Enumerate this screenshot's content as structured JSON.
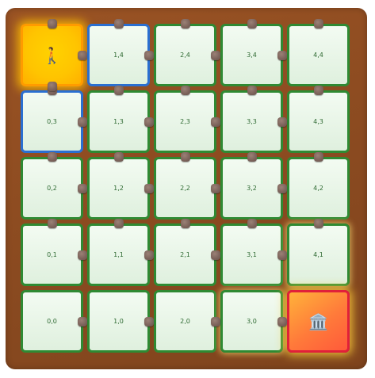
{
  "grid": {
    "rows": [
      [
        {
          "label": "",
          "icon": "🚶",
          "icon_name": "walking-person-icon",
          "state": "current"
        },
        {
          "label": "1,4",
          "state": "visited"
        },
        {
          "label": "2,4",
          "state": "normal"
        },
        {
          "label": "3,4",
          "state": "normal"
        },
        {
          "label": "4,4",
          "state": "normal"
        }
      ],
      [
        {
          "label": "0,3",
          "state": "visited"
        },
        {
          "label": "1,3",
          "state": "normal"
        },
        {
          "label": "2,3",
          "state": "normal"
        },
        {
          "label": "3,3",
          "state": "normal"
        },
        {
          "label": "4,3",
          "state": "normal"
        }
      ],
      [
        {
          "label": "0,2",
          "state": "normal"
        },
        {
          "label": "1,2",
          "state": "normal"
        },
        {
          "label": "2,2",
          "state": "normal"
        },
        {
          "label": "3,2",
          "state": "normal"
        },
        {
          "label": "4,2",
          "state": "normal"
        }
      ],
      [
        {
          "label": "0,1",
          "state": "normal"
        },
        {
          "label": "1,1",
          "state": "normal"
        },
        {
          "label": "2,1",
          "state": "normal"
        },
        {
          "label": "3,1",
          "state": "normal"
        },
        {
          "label": "4,1",
          "state": "glow"
        }
      ],
      [
        {
          "label": "0,0",
          "state": "normal"
        },
        {
          "label": "1,0",
          "state": "normal"
        },
        {
          "label": "2,0",
          "state": "normal"
        },
        {
          "label": "3,0",
          "state": "glow"
        },
        {
          "label": "",
          "icon": "🏛️",
          "icon_name": "bank-building-icon",
          "state": "goal"
        }
      ]
    ]
  },
  "colors": {
    "board": "#8a4a20",
    "cell_border": "#2f8a33",
    "visited_border": "#2a6fd1",
    "current_border": "#ff9b00",
    "goal_border": "#e0203a",
    "peg": "#7b625a"
  }
}
